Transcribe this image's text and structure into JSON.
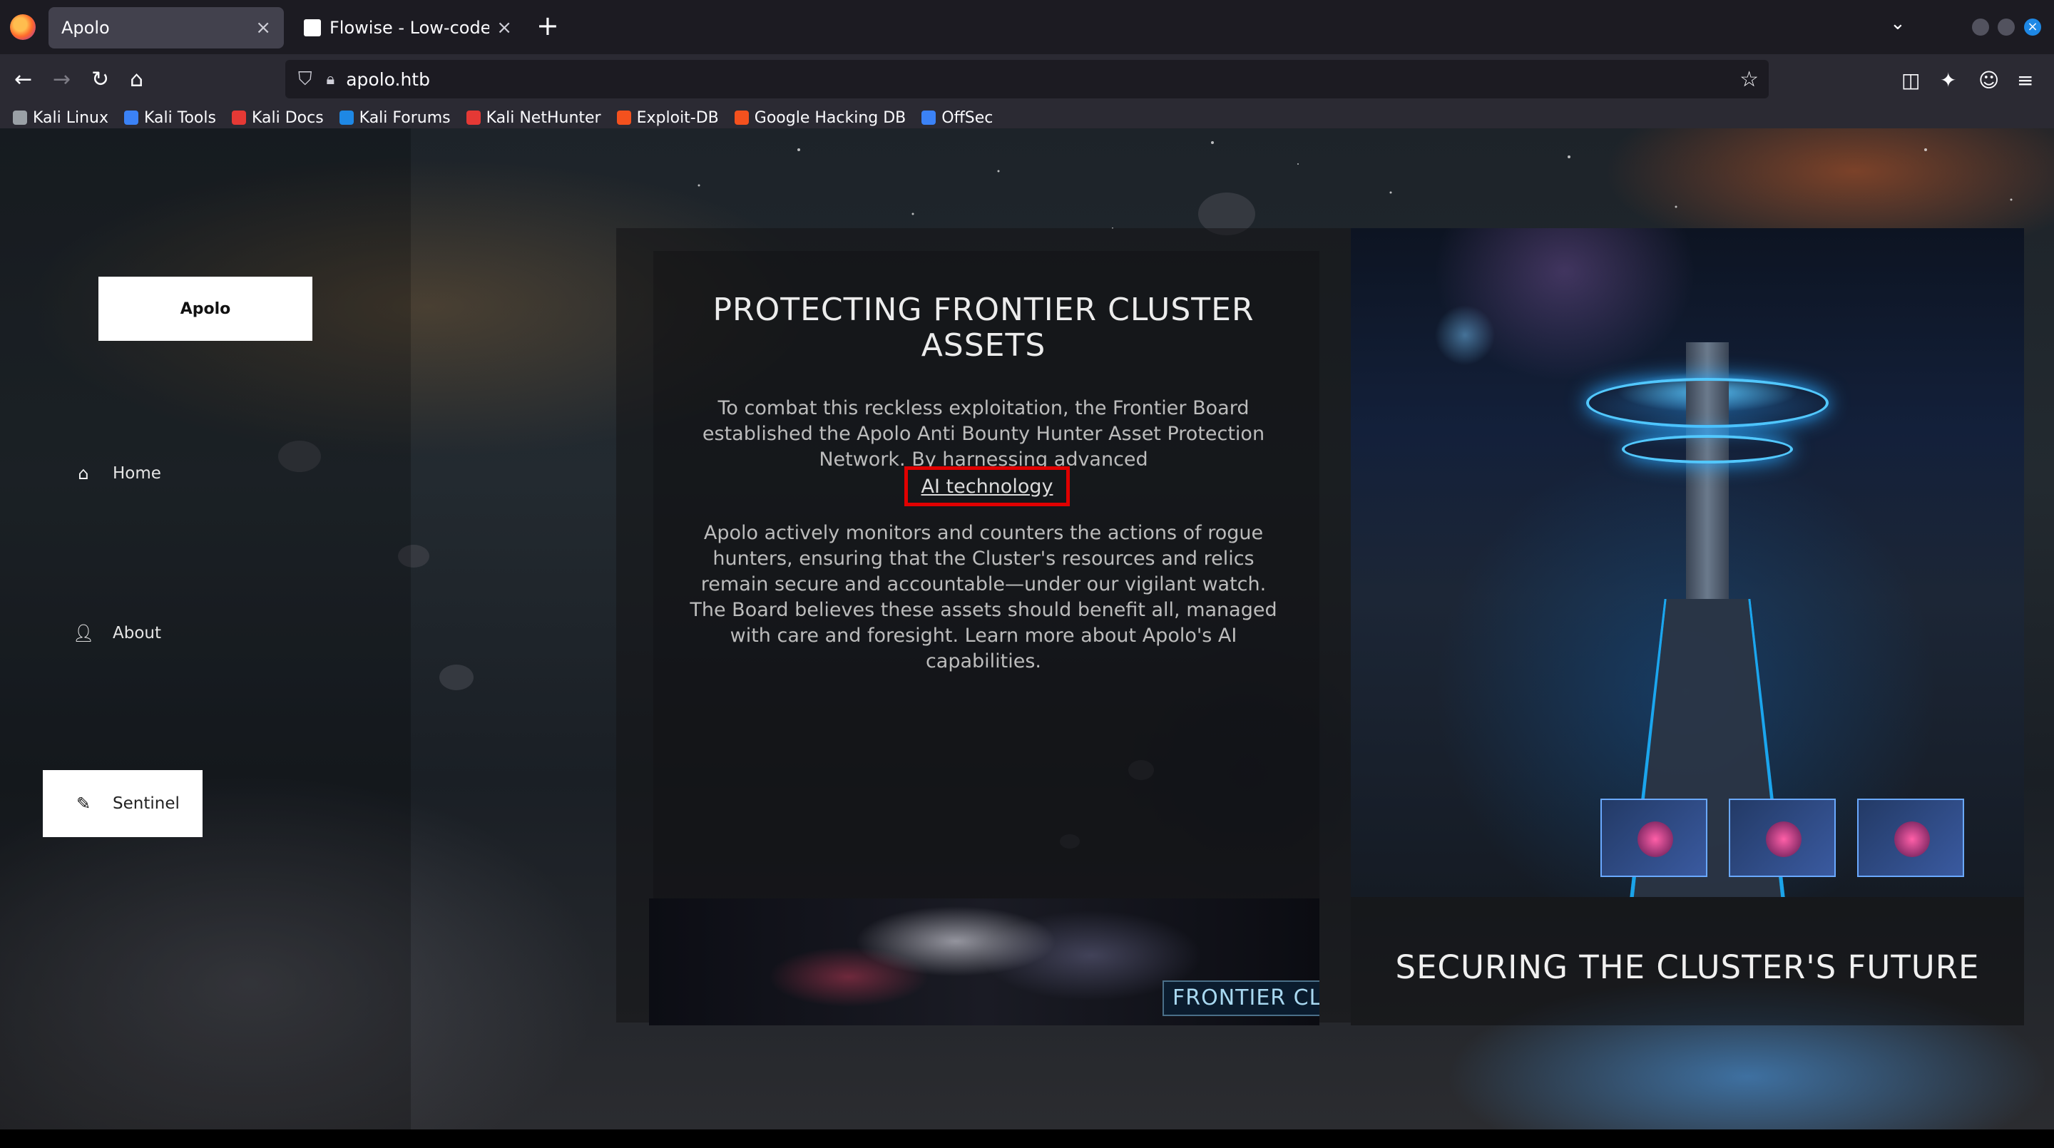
{
  "browser": {
    "tabs": [
      {
        "title": "Apolo",
        "active": true
      },
      {
        "title": "Flowise - Low-code LLM",
        "active": false
      }
    ],
    "new_tab_glyph": "+",
    "url": "apolo.htb",
    "bookmarks": [
      {
        "label": "Kali Linux",
        "icon": "kali-dragon-icon",
        "color": "#9aa0a6"
      },
      {
        "label": "Kali Tools",
        "icon": "kali-tools-icon",
        "color": "#3b82f6"
      },
      {
        "label": "Kali Docs",
        "icon": "kali-docs-icon",
        "color": "#e53935"
      },
      {
        "label": "Kali Forums",
        "icon": "kali-forums-icon",
        "color": "#1e88e5"
      },
      {
        "label": "Kali NetHunter",
        "icon": "kali-nethunter-icon",
        "color": "#e53935"
      },
      {
        "label": "Exploit-DB",
        "icon": "exploit-db-icon",
        "color": "#f4511e"
      },
      {
        "label": "Google Hacking DB",
        "icon": "ghdb-icon",
        "color": "#f4511e"
      },
      {
        "label": "OffSec",
        "icon": "offsec-icon",
        "color": "#3b82f6"
      }
    ]
  },
  "site": {
    "brand": "Apolo",
    "nav": [
      {
        "label": "Home",
        "icon": "home-icon",
        "selected": false
      },
      {
        "label": "About",
        "icon": "user-icon",
        "selected": false
      },
      {
        "label": "Sentinel",
        "icon": "pencil-icon",
        "selected": true
      }
    ],
    "hero": {
      "title_line1": "PROTECTING FRONTIER CLUSTER",
      "title_line2": "ASSETS",
      "para1": "To combat this reckless exploitation, the Frontier Board established the Apolo Anti Bounty Hunter Asset Protection Network. By harnessing advanced",
      "link": "AI technology",
      "para2": "Apolo actively monitors and counters the actions of rogue hunters, ensuring that the Cluster's resources and relics remain secure and accountable—under our vigilant watch. The Board believes these assets should benefit all, managed with care and foresight. Learn more about Apolo's AI capabilities."
    },
    "banner_sign": "FRONTIER CLA",
    "secondary_title": "SECURING THE CLUSTER'S FUTURE"
  },
  "colors": {
    "highlight_border": "#e00000",
    "chrome_dark": "#1c1b22",
    "chrome_toolbar": "#2b2a33"
  }
}
